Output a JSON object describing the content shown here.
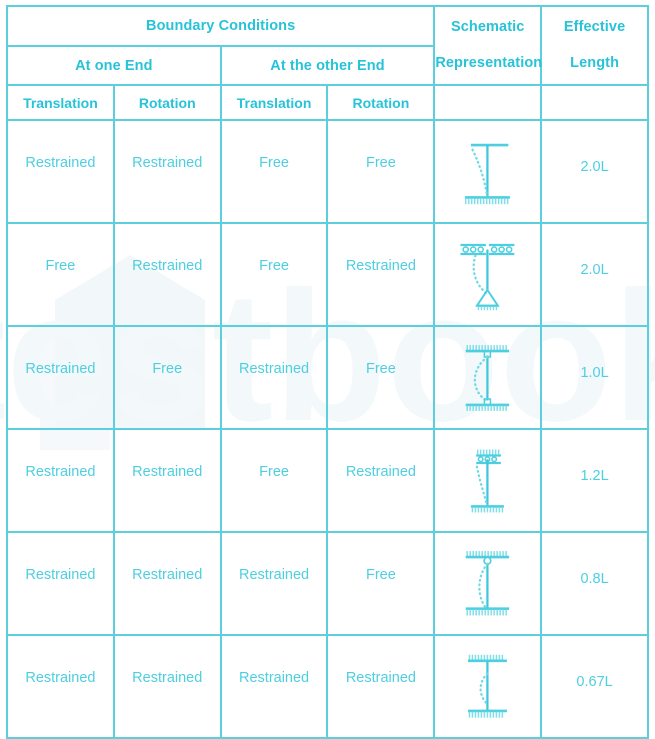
{
  "theme": {
    "border_color": "#5ccfdf",
    "header_text_color": "#27c3d8",
    "body_text_color": "#4ecfe0",
    "background_color": "#ffffff",
    "watermark_color": "#f2f7f9"
  },
  "watermark": {
    "text": "testbook",
    "logo": "testbook-house-logo"
  },
  "header": {
    "boundary_conditions": "Boundary Conditions",
    "at_one_end": "At one End",
    "at_other_end": "At the other End",
    "translation_1": "Translation",
    "rotation_1": "Rotation",
    "translation_2": "Translation",
    "rotation_2": "Rotation",
    "schematic_line1": "Schematic",
    "schematic_line2": "Representation",
    "effective_line1": "Effective",
    "effective_line2": "Length"
  },
  "rows": [
    {
      "translation_one_end": "Restrained",
      "rotation_one_end": "Restrained",
      "translation_other_end": "Free",
      "rotation_other_end": "Free",
      "schematic": "cantilever-fixed-base-free-top",
      "effective_length": "2.0L"
    },
    {
      "translation_one_end": "Free",
      "rotation_one_end": "Restrained",
      "translation_other_end": "Free",
      "rotation_other_end": "Restrained",
      "schematic": "roller-top-pinned-base",
      "effective_length": "2.0L"
    },
    {
      "translation_one_end": "Restrained",
      "rotation_one_end": "Free",
      "translation_other_end": "Restrained",
      "rotation_other_end": "Free",
      "schematic": "pinned-both-ends",
      "effective_length": "1.0L"
    },
    {
      "translation_one_end": "Restrained",
      "rotation_one_end": "Restrained",
      "translation_other_end": "Free",
      "rotation_other_end": "Restrained",
      "schematic": "fixed-base-sway-top",
      "effective_length": "1.2L"
    },
    {
      "translation_one_end": "Restrained",
      "rotation_one_end": "Restrained",
      "translation_other_end": "Restrained",
      "rotation_other_end": "Free",
      "schematic": "fixed-base-pinned-top",
      "effective_length": "0.8L"
    },
    {
      "translation_one_end": "Restrained",
      "rotation_one_end": "Restrained",
      "translation_other_end": "Restrained",
      "rotation_other_end": "Restrained",
      "schematic": "fixed-both-ends",
      "effective_length": "0.67L"
    }
  ]
}
